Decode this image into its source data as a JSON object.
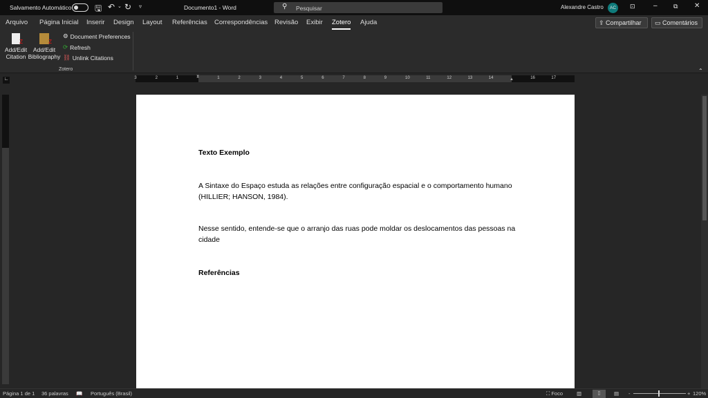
{
  "titlebar": {
    "autosave_label": "Salvamento Automático",
    "doc_title": "Documento1  -  Word",
    "search_placeholder": "Pesquisar",
    "user_name": "Alexandre Castro",
    "user_initials": "AC"
  },
  "tabs": [
    "Arquivo",
    "Página Inicial",
    "Inserir",
    "Design",
    "Layout",
    "Referências",
    "Correspondências",
    "Revisão",
    "Exibir",
    "Zotero",
    "Ajuda"
  ],
  "active_tab": "Zotero",
  "share_label": "Compartilhar",
  "comments_label": "Comentários",
  "ribbon": {
    "add_citation_1": "Add/Edit",
    "add_citation_2": "Citation",
    "add_bib_1": "Add/Edit",
    "add_bib_2": "Bibliography",
    "doc_prefs": "Document Preferences",
    "refresh": "Refresh",
    "unlink": "Unlink Citations",
    "group_label": "Zotero"
  },
  "ruler": {
    "left": [
      "3",
      "2",
      "1"
    ],
    "right": [
      "1",
      "2",
      "3",
      "4",
      "5",
      "6",
      "7",
      "8",
      "9",
      "10",
      "11",
      "12",
      "13",
      "14",
      "16",
      "17"
    ]
  },
  "document": {
    "heading": "Texto Exemplo",
    "para1": "A Sintaxe do Espaço estuda as relações entre configuração espacial e o comportamento humano (HILLIER; HANSON, 1984).",
    "para2": "Nesse sentido, entende-se que o arranjo das ruas pode moldar os deslocamentos das pessoas na cidade",
    "references": "Referências"
  },
  "status": {
    "page": "Página 1 de 1",
    "words": "36 palavras",
    "language": "Português (Brasil)",
    "focus": "Foco",
    "zoom": "120%"
  },
  "colors": {
    "avatar": "#0f7b7b",
    "zotero_red": "#b01c1c"
  }
}
